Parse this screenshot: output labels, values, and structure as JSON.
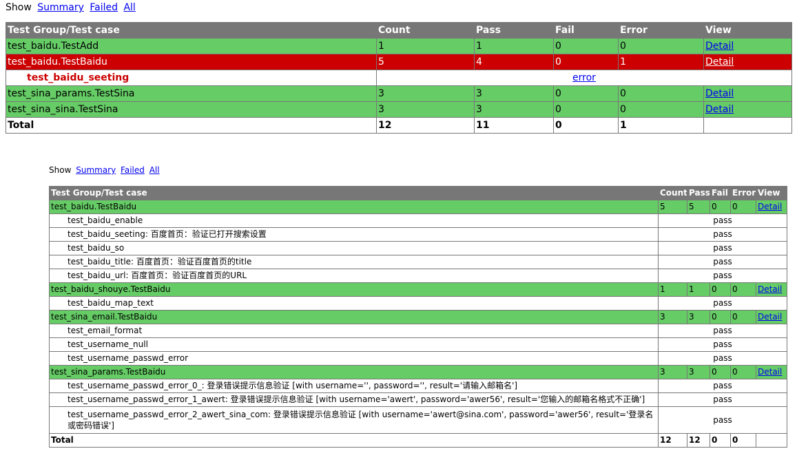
{
  "report1": {
    "show": {
      "label": "Show",
      "summary": "Summary",
      "failed": "Failed",
      "all": "All"
    },
    "headers": [
      "Test Group/Test case",
      "Count",
      "Pass",
      "Fail",
      "Error",
      "View"
    ],
    "rows": [
      {
        "name": "test_baidu.TestAdd",
        "count": "1",
        "pass": "1",
        "fail": "0",
        "error": "0",
        "view": "Detail"
      },
      {
        "name": "test_baidu.TestBaidu",
        "count": "5",
        "pass": "4",
        "fail": "0",
        "error": "1",
        "view": "Detail"
      },
      {
        "case": "test_baidu_seeting",
        "status": "error"
      },
      {
        "name": "test_sina_params.TestSina",
        "count": "3",
        "pass": "3",
        "fail": "0",
        "error": "0",
        "view": "Detail"
      },
      {
        "name": "test_sina_sina.TestSina",
        "count": "3",
        "pass": "3",
        "fail": "0",
        "error": "0",
        "view": "Detail"
      }
    ],
    "total": {
      "label": "Total",
      "count": "12",
      "pass": "11",
      "fail": "0",
      "error": "1"
    }
  },
  "report2": {
    "show": {
      "label": "Show",
      "summary": "Summary",
      "failed": "Failed",
      "all": "All"
    },
    "headers": [
      "Test Group/Test case",
      "Count",
      "Pass",
      "Fail",
      "Error",
      "View"
    ],
    "groups": [
      {
        "name": "test_baidu.TestBaidu",
        "count": "5",
        "pass": "5",
        "fail": "0",
        "error": "0",
        "view": "Detail",
        "cases": [
          {
            "name": "test_baidu_enable",
            "status": "pass"
          },
          {
            "name": "test_baidu_seeting: 百度首页：验证已打开搜索设置",
            "status": "pass"
          },
          {
            "name": "test_baidu_so",
            "status": "pass"
          },
          {
            "name": "test_baidu_title: 百度首页：验证百度首页的title",
            "status": "pass"
          },
          {
            "name": "test_baidu_url: 百度首页：验证百度首页的URL",
            "status": "pass"
          }
        ]
      },
      {
        "name": "test_baidu_shouye.TestBaidu",
        "count": "1",
        "pass": "1",
        "fail": "0",
        "error": "0",
        "view": "Detail",
        "cases": [
          {
            "name": "test_baidu_map_text",
            "status": "pass"
          }
        ]
      },
      {
        "name": "test_sina_email.TestBaidu",
        "count": "3",
        "pass": "3",
        "fail": "0",
        "error": "0",
        "view": "Detail",
        "cases": [
          {
            "name": "test_email_format",
            "status": "pass"
          },
          {
            "name": "test_username_null",
            "status": "pass"
          },
          {
            "name": "test_username_passwd_error",
            "status": "pass"
          }
        ]
      },
      {
        "name": "test_sina_params.TestBaidu",
        "count": "3",
        "pass": "3",
        "fail": "0",
        "error": "0",
        "view": "Detail",
        "cases": [
          {
            "name": "test_username_passwd_error_0_: 登录错误提示信息验证 [with username='', password='', result='请输入邮箱名']",
            "status": "pass"
          },
          {
            "name": "test_username_passwd_error_1_awert: 登录错误提示信息验证 [with username='awert', password='awer56', result='您输入的邮箱名格式不正确']",
            "status": "pass"
          },
          {
            "name": "test_username_passwd_error_2_awert_sina_com: 登录错误提示信息验证 [with username='awert@sina.com', password='awer56', result='登录名或密码错误']",
            "status": "pass"
          }
        ]
      }
    ],
    "total": {
      "label": "Total",
      "count": "12",
      "pass": "12",
      "fail": "0",
      "error": "0"
    }
  }
}
